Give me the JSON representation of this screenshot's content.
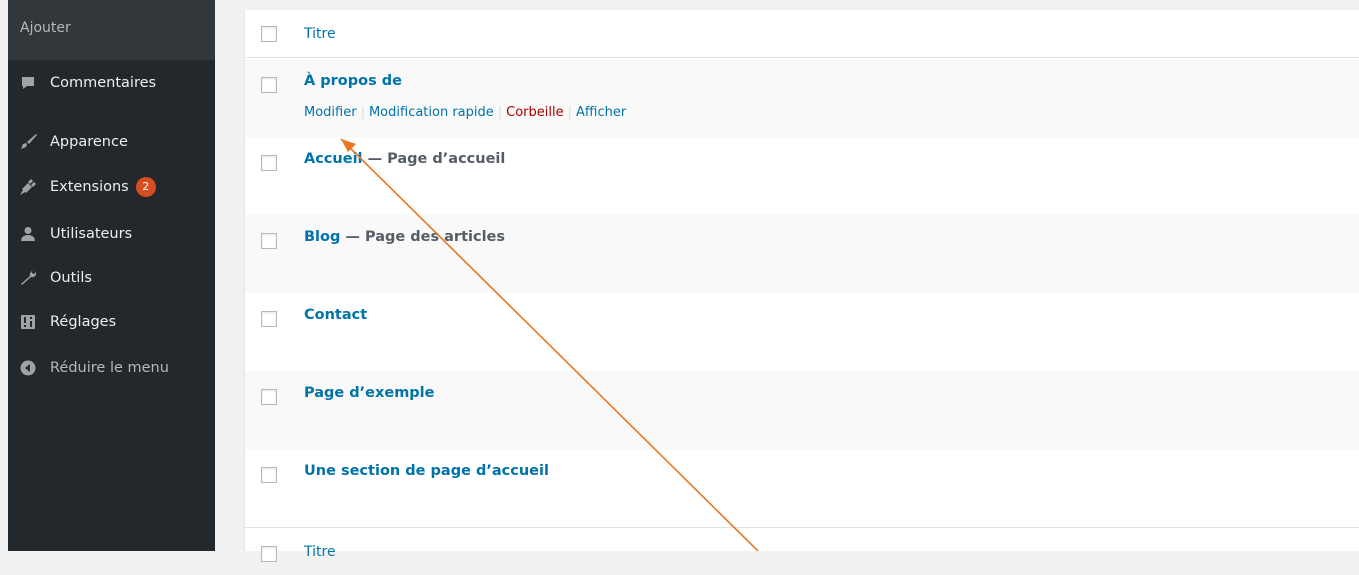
{
  "sidebar": {
    "submenu_label": "Ajouter",
    "items": [
      {
        "label": "Commentaires",
        "icon": "comment-icon"
      },
      {
        "label": "Apparence",
        "icon": "paintbrush-icon"
      },
      {
        "label": "Extensions",
        "icon": "plugin-icon",
        "badge": "2"
      },
      {
        "label": "Utilisateurs",
        "icon": "users-icon"
      },
      {
        "label": "Outils",
        "icon": "wrench-icon"
      },
      {
        "label": "Réglages",
        "icon": "settings-icon"
      },
      {
        "label": "Réduire le menu",
        "icon": "collapse-icon"
      }
    ]
  },
  "table": {
    "header_title": "Titre",
    "footer_title": "Titre",
    "rows": [
      {
        "title": "À propos de",
        "state": ""
      },
      {
        "title": "Accueil",
        "state": " — Page d’accueil"
      },
      {
        "title": "Blog",
        "state": " — Page des articles"
      },
      {
        "title": "Contact",
        "state": ""
      },
      {
        "title": "Page d’exemple",
        "state": ""
      },
      {
        "title": "Une section de page d’accueil",
        "state": ""
      }
    ],
    "row_actions": {
      "edit": "Modifier",
      "quick_edit": "Modification rapide",
      "trash": "Corbeille",
      "view": "Afficher",
      "separator": "|"
    }
  },
  "colors": {
    "sidebar_bg": "#23282d",
    "link": "#0073aa",
    "trash": "#aa0000",
    "badge": "#d54e21",
    "annotation_arrow": "#e87722"
  }
}
